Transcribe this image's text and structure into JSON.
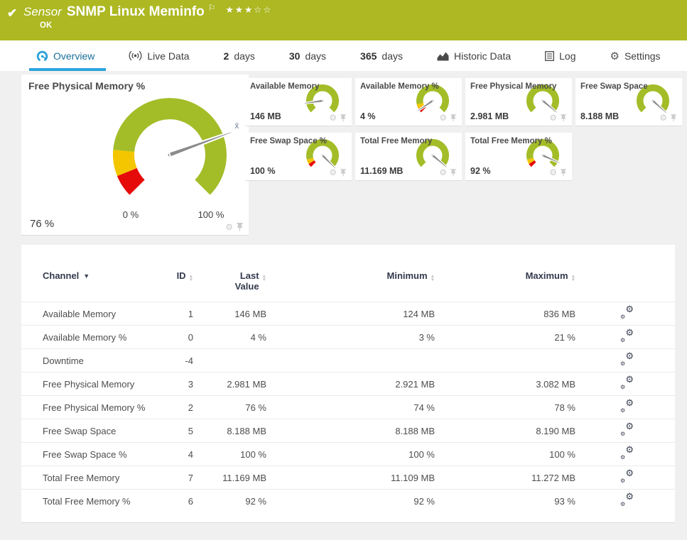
{
  "header": {
    "kind_label": "Sensor",
    "title": "SNMP Linux Meminfo",
    "status": "OK",
    "rating": {
      "filled": 3,
      "total": 5
    }
  },
  "tabs": [
    {
      "id": "overview",
      "icon": "gauge-icon",
      "label": "Overview",
      "active": true
    },
    {
      "id": "live-data",
      "icon": "live-icon",
      "label": "Live Data"
    },
    {
      "id": "2-days",
      "num": "2",
      "label": "days"
    },
    {
      "id": "30-days",
      "num": "30",
      "label": "days"
    },
    {
      "id": "365-days",
      "num": "365",
      "label": "days"
    },
    {
      "id": "historic-data",
      "icon": "chart-icon",
      "label": "Historic Data"
    },
    {
      "id": "log",
      "icon": "log-icon",
      "label": "Log"
    },
    {
      "id": "settings",
      "icon": "gear-icon",
      "label": "Settings"
    }
  ],
  "colors": {
    "header_bg": "#adb822",
    "accent_blue": "#2ba3dc",
    "active_tab_text": "#1a6f9b",
    "gauge_green": "#a3bd28",
    "gauge_yellow": "#f4c600",
    "gauge_red": "#e60b0b",
    "needle_gray": "#8b8b8b",
    "page_bg": "#f0f0f0",
    "card_bg": "#ffffff"
  },
  "gauges": {
    "card_corner_icons": [
      "gear-icon",
      "pin-icon"
    ],
    "main": {
      "title": "Free Physical Memory %",
      "value": "76 %",
      "min_label": "0 %",
      "max_label": "100 %",
      "avg_label": "x̄",
      "needle_deg": 20,
      "segments": [
        {
          "color": "red",
          "from": 0,
          "to": 0.085
        },
        {
          "color": "yellow",
          "from": 0.085,
          "to": 0.185
        },
        {
          "color": "green",
          "from": 0.185,
          "to": 1
        }
      ]
    },
    "small": [
      {
        "title": "Available Memory",
        "value": "146 MB",
        "needle_deg": 188,
        "segments": [
          {
            "color": "green",
            "from": 0,
            "to": 1
          }
        ]
      },
      {
        "title": "Available Memory %",
        "value": "4 %",
        "needle_deg": 214,
        "segments": [
          {
            "color": "red",
            "from": 0,
            "to": 0.06
          },
          {
            "color": "yellow",
            "from": 0.06,
            "to": 0.12
          },
          {
            "color": "green",
            "from": 0.12,
            "to": 1
          }
        ]
      },
      {
        "title": "Free Physical Memory",
        "value": "2.981 MB",
        "needle_deg": -40,
        "segments": [
          {
            "color": "green",
            "from": 0,
            "to": 1
          }
        ]
      },
      {
        "title": "Free Swap Space",
        "value": "8.188 MB",
        "needle_deg": -42,
        "segments": [
          {
            "color": "green",
            "from": 0,
            "to": 1
          }
        ]
      },
      {
        "title": "Free Swap Space %",
        "value": "100 %",
        "needle_deg": -45,
        "segments": [
          {
            "color": "red",
            "from": 0,
            "to": 0.05
          },
          {
            "color": "yellow",
            "from": 0.05,
            "to": 0.11
          },
          {
            "color": "green",
            "from": 0.11,
            "to": 1
          }
        ]
      },
      {
        "title": "Total Free Memory",
        "value": "11.169 MB",
        "needle_deg": -40,
        "segments": [
          {
            "color": "green",
            "from": 0,
            "to": 1
          }
        ]
      },
      {
        "title": "Total Free Memory %",
        "value": "92 %",
        "needle_deg": -24,
        "segments": [
          {
            "color": "red",
            "from": 0,
            "to": 0.05
          },
          {
            "color": "yellow",
            "from": 0.05,
            "to": 0.11
          },
          {
            "color": "green",
            "from": 0.11,
            "to": 1
          }
        ]
      }
    ]
  },
  "table": {
    "columns": [
      {
        "key": "channel",
        "label": "Channel",
        "sort": "active-desc"
      },
      {
        "key": "id",
        "label": "ID",
        "sort": "both"
      },
      {
        "key": "last",
        "label": "Last Value",
        "sort": "both"
      },
      {
        "key": "min",
        "label": "Minimum",
        "sort": "both"
      },
      {
        "key": "max",
        "label": "Maximum",
        "sort": "both"
      },
      {
        "key": "actions",
        "label": "",
        "sort": "none"
      }
    ],
    "action_icon": "edit-channel-gears-icon",
    "rows": [
      {
        "channel": "Available Memory",
        "id": "1",
        "last": "146 MB",
        "min": "124 MB",
        "max": "836 MB"
      },
      {
        "channel": "Available Memory %",
        "id": "0",
        "last": "4 %",
        "min": "3 %",
        "max": "21 %"
      },
      {
        "channel": "Downtime",
        "id": "-4",
        "last": "",
        "min": "",
        "max": ""
      },
      {
        "channel": "Free Physical Memory",
        "id": "3",
        "last": "2.981 MB",
        "min": "2.921 MB",
        "max": "3.082 MB"
      },
      {
        "channel": "Free Physical Memory %",
        "id": "2",
        "last": "76 %",
        "min": "74 %",
        "max": "78 %"
      },
      {
        "channel": "Free Swap Space",
        "id": "5",
        "last": "8.188 MB",
        "min": "8.188 MB",
        "max": "8.190 MB"
      },
      {
        "channel": "Free Swap Space %",
        "id": "4",
        "last": "100 %",
        "min": "100 %",
        "max": "100 %"
      },
      {
        "channel": "Total Free Memory",
        "id": "7",
        "last": "11.169 MB",
        "min": "11.109 MB",
        "max": "11.272 MB"
      },
      {
        "channel": "Total Free Memory %",
        "id": "6",
        "last": "92 %",
        "min": "92 %",
        "max": "93 %"
      }
    ]
  }
}
